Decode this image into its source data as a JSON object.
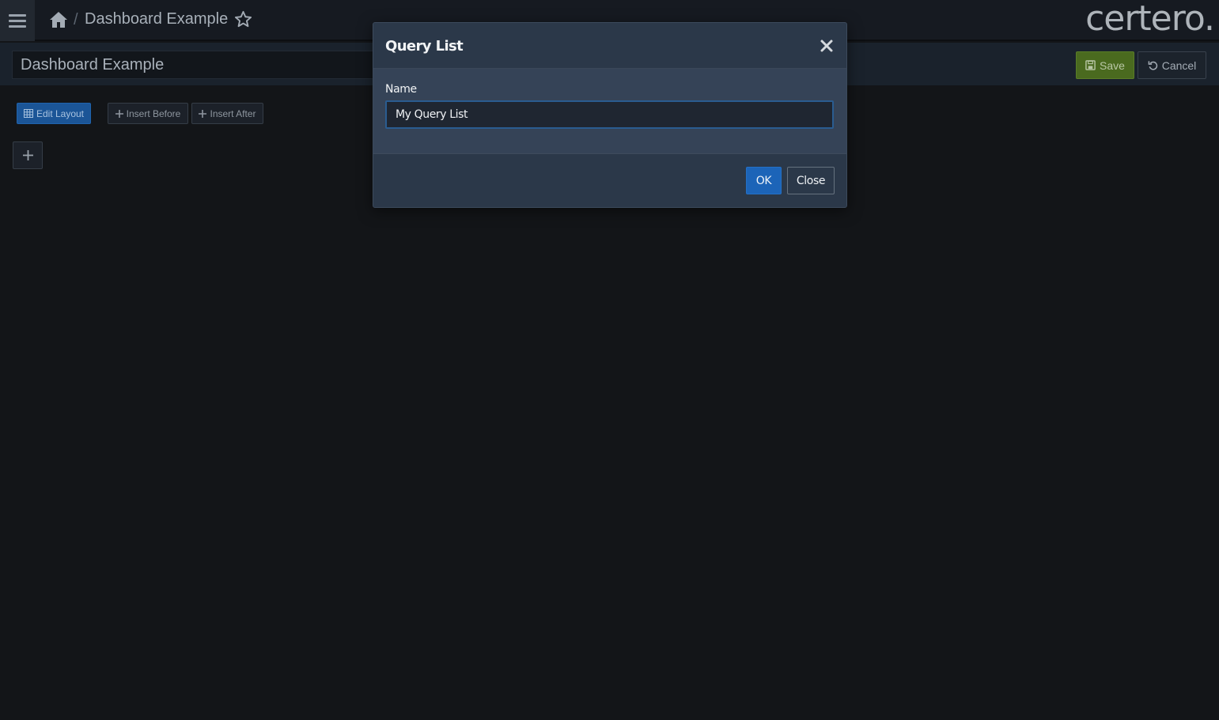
{
  "topbar": {
    "menu_icon": "hamburger-icon",
    "home_icon": "home-icon",
    "breadcrumb_separator": "/",
    "breadcrumb_title": "Dashboard Example",
    "favorite_icon": "star-outline-icon",
    "logo_text": "certero."
  },
  "editor": {
    "dashboard_name": "Dashboard Example",
    "save_label": "Save",
    "save_icon": "floppy-disk-icon",
    "cancel_label": "Cancel",
    "cancel_icon": "undo-icon"
  },
  "toolbar": {
    "edit_layout_label": "Edit Layout",
    "edit_layout_icon": "grid-icon",
    "insert_before_label": "Insert Before",
    "insert_after_label": "Insert After",
    "add_icon": "plus-icon"
  },
  "modal": {
    "title": "Query List",
    "close_icon": "close-icon",
    "name_label": "Name",
    "name_value": "My Query List",
    "ok_label": "OK",
    "close_label": "Close"
  },
  "colors": {
    "background": "#131518",
    "save_green": "#4a6a1f",
    "primary_blue": "#1c64b8",
    "modal_bg": "#2b3849"
  }
}
